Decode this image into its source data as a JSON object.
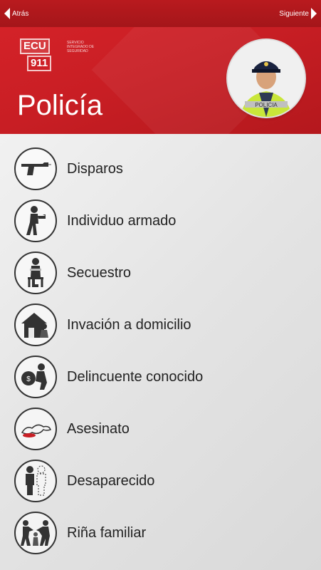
{
  "nav": {
    "back_label": "Atrás",
    "next_label": "Siguiente"
  },
  "header": {
    "title": "Policía",
    "logo": {
      "line1": "ECU",
      "line2": "911",
      "tagline": "SERVICIO INTEGRADO DE SEGURIDAD"
    },
    "avatar_text": "POLICIA"
  },
  "items": [
    {
      "label": "Disparos",
      "icon": "gun-icon"
    },
    {
      "label": "Individuo armado",
      "icon": "armed-person-icon"
    },
    {
      "label": "Secuestro",
      "icon": "kidnapping-icon"
    },
    {
      "label": "Invación a domicilio",
      "icon": "house-break-in-icon"
    },
    {
      "label": "Delincuente conocido",
      "icon": "thief-with-bag-icon"
    },
    {
      "label": "Asesinato",
      "icon": "body-outline-icon"
    },
    {
      "label": "Desaparecido",
      "icon": "missing-person-icon"
    },
    {
      "label": "Riña familiar",
      "icon": "family-fight-icon"
    }
  ],
  "colors": {
    "header_red": "#c81e24",
    "topbar_red": "#b01a1e",
    "text": "#222222"
  }
}
